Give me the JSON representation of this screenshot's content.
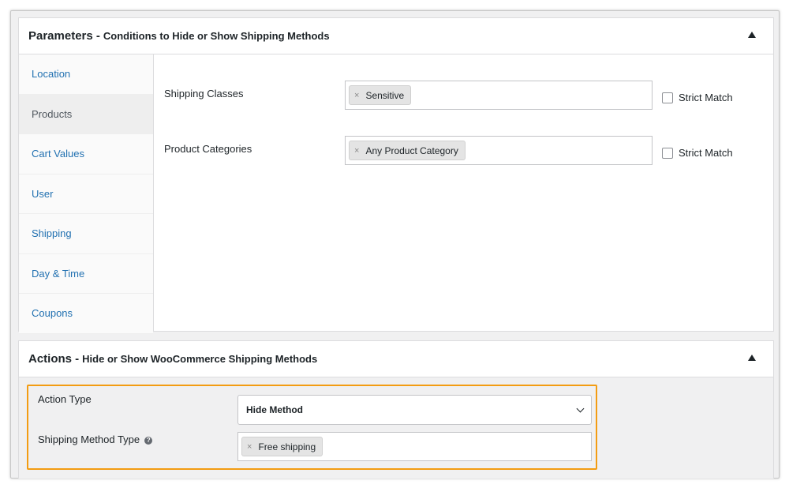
{
  "parameters": {
    "title": "Parameters -",
    "subtitle": "Conditions to Hide or Show Shipping Methods",
    "tabs": [
      {
        "label": "Location",
        "active": false
      },
      {
        "label": "Products",
        "active": true
      },
      {
        "label": "Cart Values",
        "active": false
      },
      {
        "label": "User",
        "active": false
      },
      {
        "label": "Shipping",
        "active": false
      },
      {
        "label": "Day & Time",
        "active": false
      },
      {
        "label": "Coupons",
        "active": false
      }
    ],
    "fields": {
      "shipping_classes": {
        "label": "Shipping Classes",
        "token": "Sensitive",
        "strict_label": "Strict Match"
      },
      "product_categories": {
        "label": "Product Categories",
        "token": "Any Product Category",
        "strict_label": "Strict Match"
      }
    }
  },
  "actions": {
    "title": "Actions -",
    "subtitle": "Hide or Show WooCommerce Shipping Methods",
    "action_type": {
      "label": "Action Type",
      "value": "Hide Method"
    },
    "shipping_method_type": {
      "label": "Shipping Method Type",
      "token": "Free shipping"
    }
  },
  "colors": {
    "link": "#2271b1",
    "highlight": "#f39c12"
  },
  "icons": {
    "remove": "×",
    "help": "?"
  }
}
